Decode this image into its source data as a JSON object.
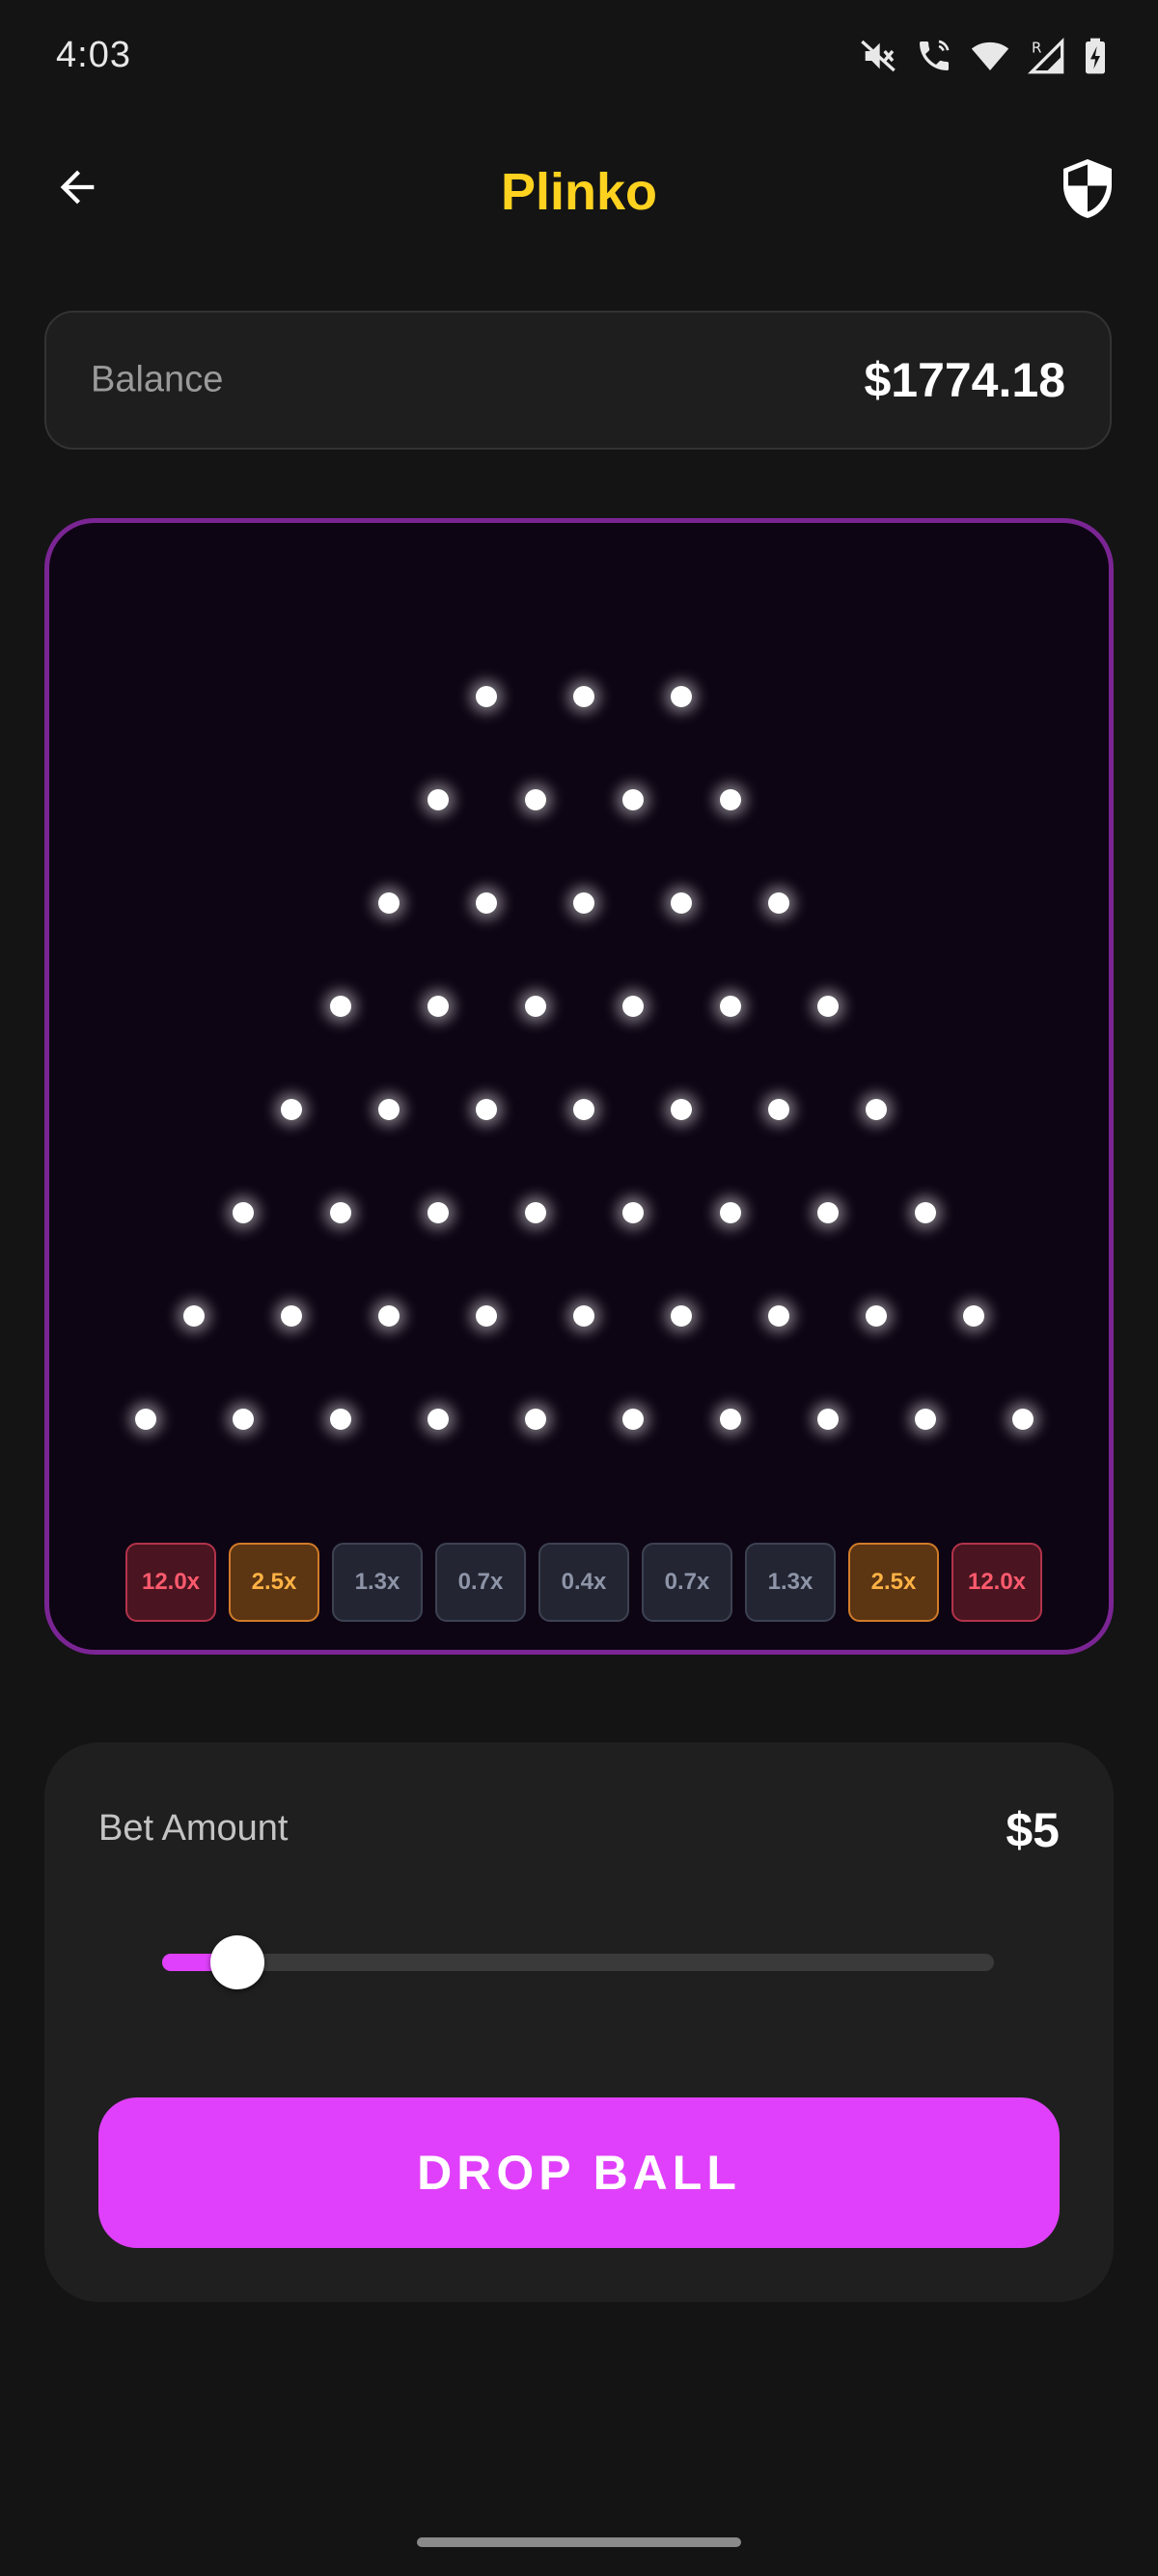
{
  "status_bar": {
    "time": "4:03",
    "icons": [
      "mute-icon",
      "wifi-calling-icon",
      "wifi-icon",
      "signal-roaming-icon",
      "battery-charging-icon"
    ]
  },
  "app_bar": {
    "title": "Plinko",
    "title_color": "#FFD21F",
    "back_icon": "arrow-left-icon",
    "action_icon": "shield-icon"
  },
  "balance": {
    "label": "Balance",
    "value": "$1774.18"
  },
  "board": {
    "border_color": "#7A2593",
    "peg_rows": [
      3,
      4,
      5,
      6,
      7,
      8,
      9,
      10
    ],
    "buckets": [
      {
        "label": "12.0x",
        "tier": "high"
      },
      {
        "label": "2.5x",
        "tier": "mid"
      },
      {
        "label": "1.3x",
        "tier": "low"
      },
      {
        "label": "0.7x",
        "tier": "low"
      },
      {
        "label": "0.4x",
        "tier": "low"
      },
      {
        "label": "0.7x",
        "tier": "low"
      },
      {
        "label": "1.3x",
        "tier": "low"
      },
      {
        "label": "2.5x",
        "tier": "mid"
      },
      {
        "label": "12.0x",
        "tier": "high"
      }
    ]
  },
  "bet": {
    "label": "Bet Amount",
    "value": "$5",
    "slider_fraction": 0.09,
    "accent_color": "#E040FB"
  },
  "action": {
    "drop_label": "DROP BALL"
  }
}
